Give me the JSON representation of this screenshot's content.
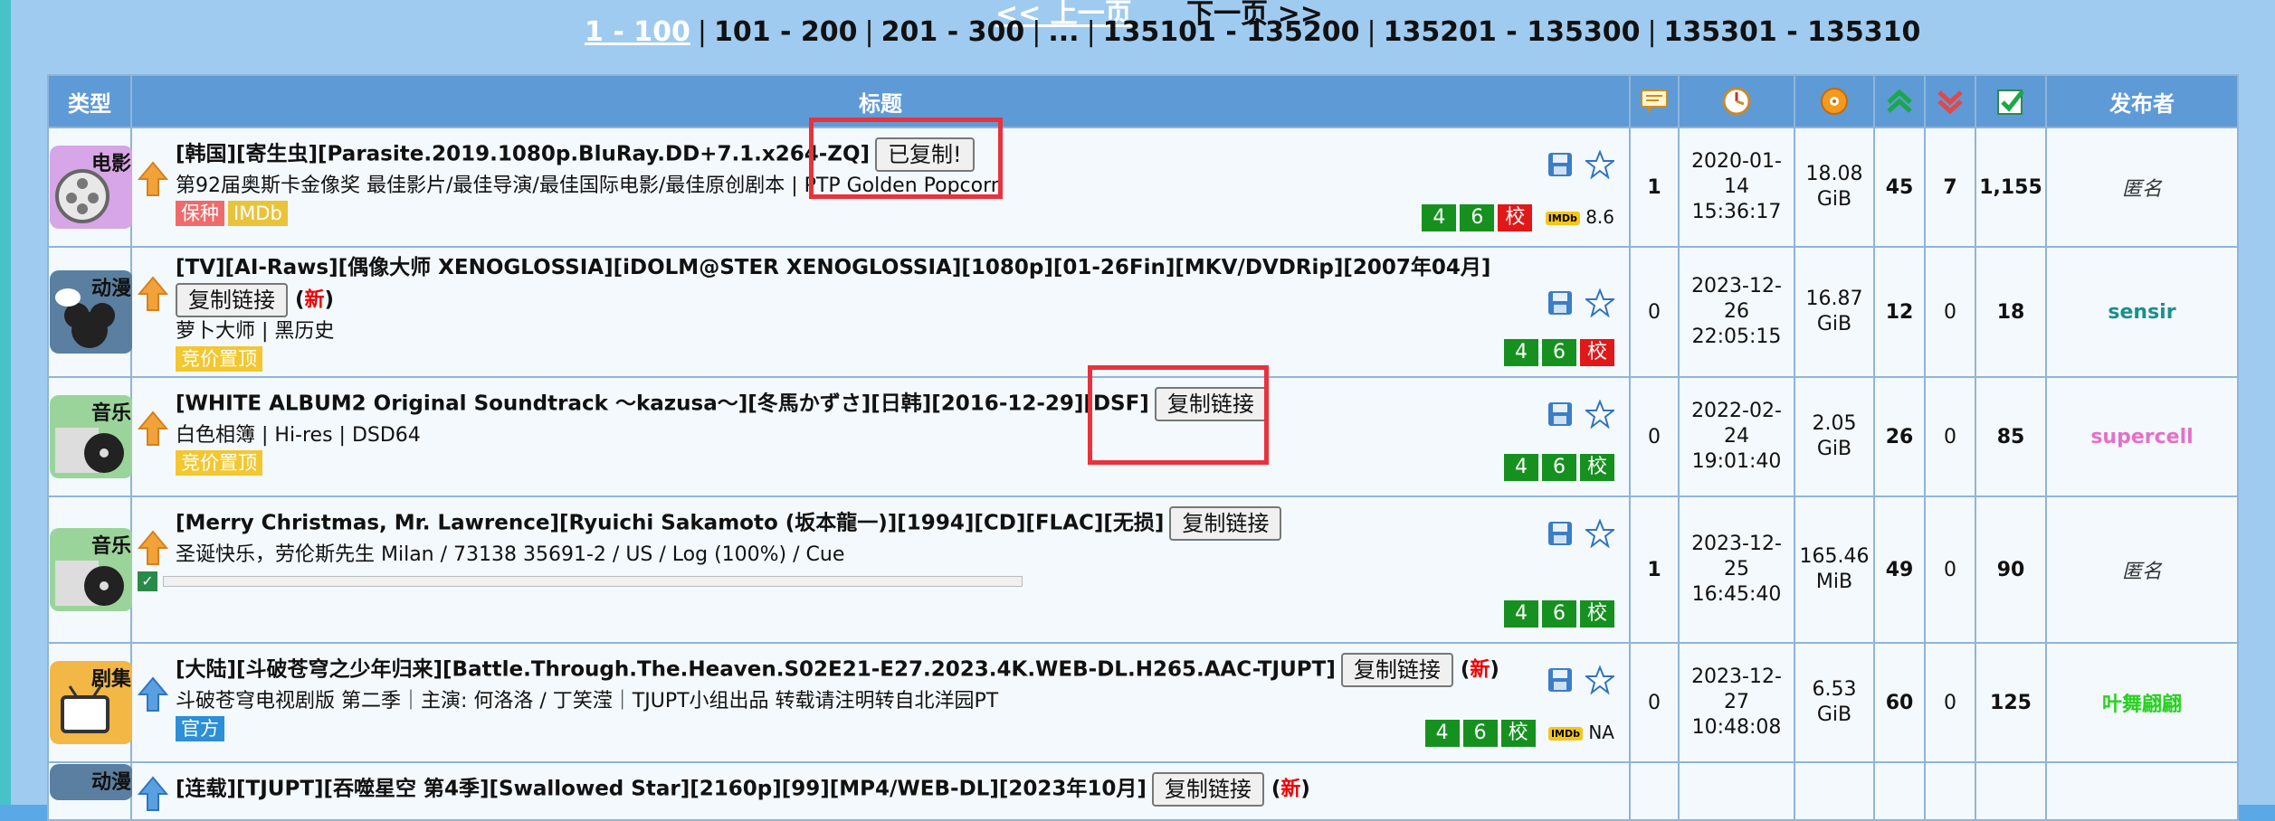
{
  "pager": {
    "prev": "<< 上一页",
    "next": "下一页 >>",
    "pages": [
      "1 - 100",
      "101 - 200",
      "201 - 300",
      "...",
      "135101 - 135200",
      "135201 - 135300",
      "135301 - 135310"
    ]
  },
  "table": {
    "headers": {
      "type": "类型",
      "title": "标题",
      "uploader": "发布者"
    },
    "rows": [
      {
        "category": "电影",
        "title": "[韩国][寄生虫][Parasite.2019.1080p.BluRay.DD+7.1.x264-ZQ]",
        "copy_label": "已复制!",
        "subtitle": "第92届奥斯卡金像奖 最佳影片/最佳导演/最佳国际电影/最佳原创剧本 | PTP Golden Popcorn",
        "tags": [
          "保种",
          "IMDb"
        ],
        "badges": [
          "4",
          "6",
          "校"
        ],
        "imdb": "8.6",
        "comments": "1",
        "time": "2020-01-14 15:36:17",
        "size": "18.08 GiB",
        "seeders": "45",
        "leechers": "7",
        "completed": "1,155",
        "uploader": "匿名"
      },
      {
        "category": "动漫",
        "title": "[TV][AI-Raws][偶像大师 XENOGLOSSIA][iDOLM@STER XENOGLOSSIA][1080p][01-26Fin][MKV/DVDRip][2007年04月]",
        "copy_label": "复制链接",
        "new_label": "新",
        "subtitle": "萝卜大师 | 黑历史",
        "tags": [
          "竞价置顶"
        ],
        "badges": [
          "4",
          "6",
          "校"
        ],
        "comments": "0",
        "time": "2023-12-26 22:05:15",
        "size": "16.87 GiB",
        "seeders": "12",
        "leechers": "0",
        "completed": "18",
        "uploader": "sensir"
      },
      {
        "category": "音乐",
        "title": "[WHITE ALBUM2 Original Soundtrack ～kazusa～][冬馬かずさ][日韩][2016-12-29][DSF]",
        "copy_label": "复制链接",
        "subtitle": "白色相簿 | Hi-res | DSD64",
        "tags": [
          "竞价置顶"
        ],
        "badges": [
          "4",
          "6",
          "校"
        ],
        "comments": "0",
        "time": "2022-02-24 19:01:40",
        "size": "2.05 GiB",
        "seeders": "26",
        "leechers": "0",
        "completed": "85",
        "uploader": "supercell"
      },
      {
        "category": "音乐",
        "title": "[Merry Christmas, Mr. Lawrence][Ryuichi Sakamoto (坂本龍一)][1994][CD][FLAC][无损]",
        "copy_label": "复制链接",
        "subtitle": "圣诞快乐，劳伦斯先生 Milan / 73138 35691-2 / US / Log (100%) / Cue",
        "tags": [],
        "badges": [
          "4",
          "6",
          "校"
        ],
        "comments": "1",
        "time": "2023-12-25 16:45:40",
        "size": "165.46 MiB",
        "seeders": "49",
        "leechers": "0",
        "completed": "90",
        "uploader": "匿名"
      },
      {
        "category": "剧集",
        "title": "[大陆][斗破苍穹之少年归来][Battle.Through.The.Heaven.S02E21-E27.2023.4K.WEB-DL.H265.AAC-TJUPT]",
        "copy_label": "复制链接",
        "new_label": "新",
        "subtitle": "斗破苍穹电视剧版 第二季｜主演: 何洛洛 / 丁笑滢｜TJUPT小组出品 转载请注明转自北洋园PT",
        "tags": [
          "官方"
        ],
        "badges": [
          "4",
          "6",
          "校"
        ],
        "imdb": "NA",
        "comments": "0",
        "time": "2023-12-27 10:48:08",
        "size": "6.53 GiB",
        "seeders": "60",
        "leechers": "0",
        "completed": "125",
        "uploader": "叶舞翩翩"
      },
      {
        "category": "动漫",
        "title": "[连载][TJUPT][吞噬星空 第4季][Swallowed Star][2160p][99][MP4/WEB-DL][2023年10月]",
        "copy_label": "复制链接",
        "new_label": "新"
      }
    ]
  },
  "colors": {
    "header_bg": "#5e9ad6",
    "row_bg": "#f3f9fd",
    "badge_green": "#16911f",
    "badge_red": "#e01818",
    "highlight": "#e8323c"
  }
}
